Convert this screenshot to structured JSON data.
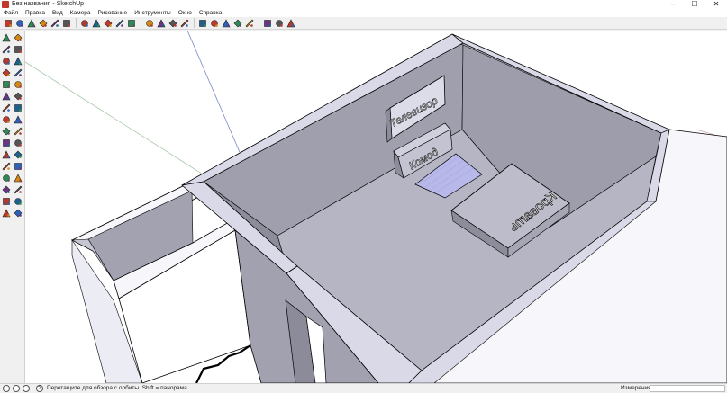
{
  "window": {
    "title": "Без названия - SketchUp",
    "controls": {
      "minimize": "–",
      "maximize": "☐",
      "close": "✕"
    }
  },
  "menu": {
    "items": [
      "Файл",
      "Правка",
      "Вид",
      "Камера",
      "Рисование",
      "Инструменты",
      "Окно",
      "Справка"
    ]
  },
  "toolbar": {
    "tools": [
      "select-icon",
      "pencil-icon",
      "rectangle-icon",
      "circle-icon",
      "arc-icon",
      "eraser-icon",
      "paint-bucket-icon",
      "push-pull-icon",
      "move-icon",
      "rotate-icon",
      "offset-icon",
      "orbit-icon",
      "pan-icon",
      "zoom-icon",
      "zoom-extents-icon",
      "components-icon",
      "materials-icon",
      "section-icon",
      "standard-views-icon",
      "styles-icon",
      "warehouse-icon",
      "extension-icon",
      "layout-icon"
    ]
  },
  "sidebar": {
    "tools": [
      "select-icon",
      "component-icon",
      "paint-bucket-icon",
      "eraser-icon",
      "rectangle-icon",
      "line-icon",
      "circle-icon",
      "arc-icon",
      "polygon-icon",
      "freehand-icon",
      "move-icon",
      "push-pull-icon",
      "rotate-icon",
      "follow-me-icon",
      "scale-icon",
      "offset-icon",
      "tape-measure-icon",
      "text-icon",
      "protractor-icon",
      "axes-icon",
      "dimension-icon",
      "3d-text-icon",
      "orbit-icon",
      "pan-icon",
      "zoom-icon",
      "zoom-window-icon",
      "zoom-extents-icon",
      "previous-view-icon",
      "position-camera-icon",
      "look-around-icon",
      "walk-icon",
      "section-plane-icon"
    ]
  },
  "model": {
    "labels": {
      "tv": "Телевизор",
      "dresser": "Комод",
      "bed": "Кровать"
    }
  },
  "status": {
    "hint": "Перетащите для обзора с орбиты.  Shift = панорама",
    "measure_label": "Измерения",
    "measure_value": ""
  },
  "colors": {
    "wall_top": "#d9d9e8",
    "wall_side": "#9a99a8",
    "floor": "#b4b3c1",
    "outer_wall": "#f4f4f9",
    "rug": "#b8b8ea"
  }
}
